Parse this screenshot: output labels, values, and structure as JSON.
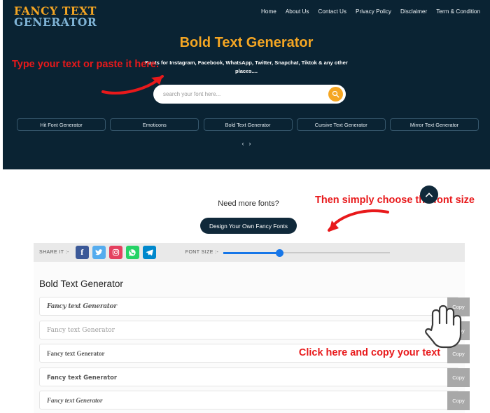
{
  "brand": {
    "line1": "FANCY TEXT",
    "line2": "GENERATOR",
    "color_line1": "#f5a623",
    "color_line2": "#7fb3d5"
  },
  "nav": {
    "items": [
      {
        "label": "Home"
      },
      {
        "label": "About Us"
      },
      {
        "label": "Contact Us"
      },
      {
        "label": "Privacy Policy"
      },
      {
        "label": "Disclaimer"
      },
      {
        "label": "Term & Condition"
      }
    ]
  },
  "hero": {
    "title": "Bold Text Generator",
    "subtitle": "Fonts for Instagram, Facebook, WhatsApp, Twitter, Snapchat, Tiktok & any other places....",
    "background": "#0a2333",
    "title_color": "#f5a623"
  },
  "search": {
    "placeholder": "search your font here...",
    "value": "",
    "button_icon": "search-icon",
    "button_color": "#f5a623"
  },
  "categories": {
    "items": [
      {
        "label": "Hit Font Generator"
      },
      {
        "label": "Emoticons"
      },
      {
        "label": "Bold Text Generator"
      },
      {
        "label": "Cursive Text Generator"
      },
      {
        "label": "Mirror Text Generator"
      }
    ]
  },
  "carousel": {
    "prev": "‹",
    "next": "›"
  },
  "annotations": {
    "type_here": "Type your text or paste it here.",
    "choose_size": "Then simply choose the font size",
    "click_copy": "Click here and copy your text",
    "color": "#e8191b"
  },
  "promo": {
    "question": "Need more fonts?",
    "button_label": "Design Your Own Fancy Fonts"
  },
  "scroll_top": {
    "icon": "chevron-up-icon"
  },
  "toolbar": {
    "share_label": "SHARE IT :-",
    "share_icons": [
      {
        "name": "facebook-icon",
        "glyph": "f",
        "color": "#3b5998"
      },
      {
        "name": "twitter-icon",
        "glyph": "✈",
        "color": "#55acee"
      },
      {
        "name": "instagram-icon",
        "glyph": "▣",
        "color": "#e4405f"
      },
      {
        "name": "whatsapp-icon",
        "glyph": "✆",
        "color": "#25d366"
      },
      {
        "name": "telegram-icon",
        "glyph": "➤",
        "color": "#0088cc"
      }
    ],
    "font_size_label": "FONT SIZE :-",
    "font_size_percent": 34,
    "slider_color": "#1676e8"
  },
  "results": {
    "title": "Bold Text Generator",
    "copy_label": "Copy",
    "rows": [
      {
        "text": "Fancy text Generator",
        "style": "f-fraktur"
      },
      {
        "text": "Fancy text Generator",
        "style": "f-serif-light"
      },
      {
        "text": "Fancy text Generator",
        "style": "f-serif"
      },
      {
        "text": "Fancy text Generator",
        "style": "f-sans"
      },
      {
        "text": "Fancy text Generator",
        "style": "f-italic"
      }
    ]
  }
}
